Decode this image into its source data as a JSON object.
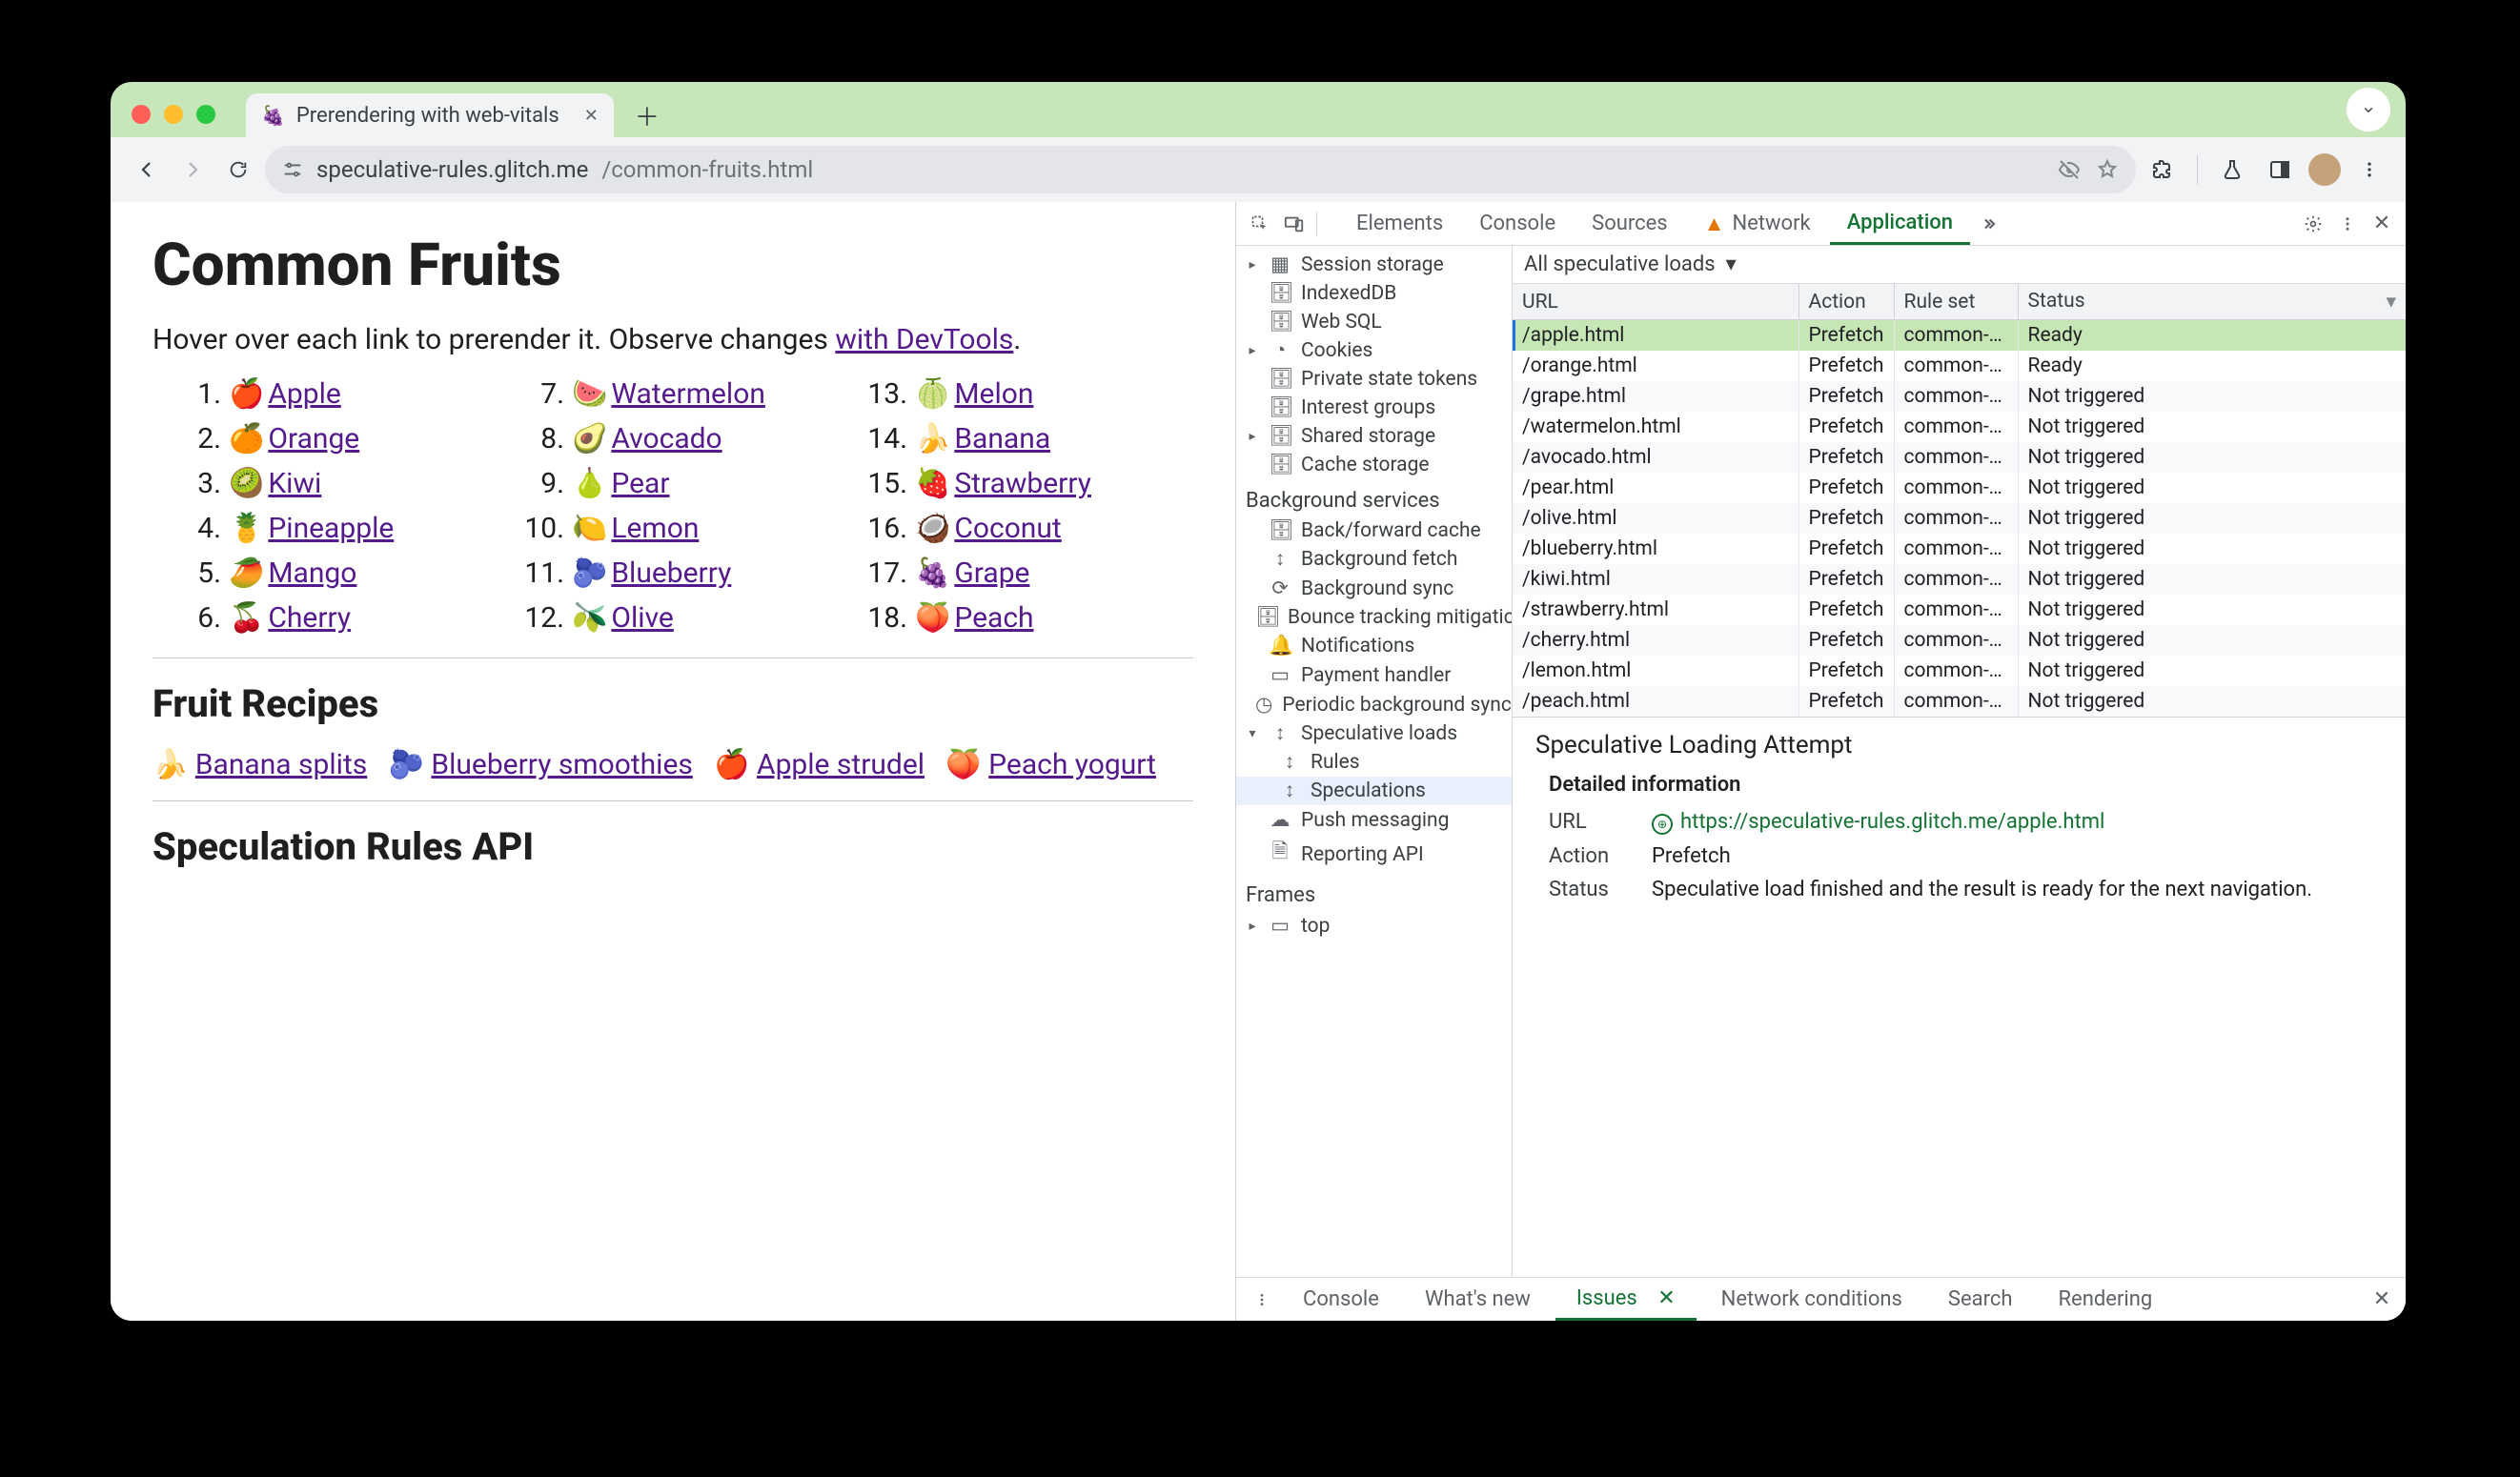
{
  "chrome": {
    "tab_title": "Prerendering with web-vitals",
    "url_site": "speculative-rules.glitch.me",
    "url_path": "/common-fruits.html"
  },
  "page": {
    "h1": "Common Fruits",
    "intro_a": "Hover over each link to prerender it. Observe changes ",
    "intro_link": "with DevTools",
    "intro_b": ".",
    "fruits": [
      {
        "n": "1.",
        "em": "🍎",
        "t": "Apple"
      },
      {
        "n": "2.",
        "em": "🍊",
        "t": "Orange"
      },
      {
        "n": "3.",
        "em": "🥝",
        "t": "Kiwi"
      },
      {
        "n": "4.",
        "em": "🍍",
        "t": "Pineapple"
      },
      {
        "n": "5.",
        "em": "🥭",
        "t": "Mango"
      },
      {
        "n": "6.",
        "em": "🍒",
        "t": "Cherry"
      },
      {
        "n": "7.",
        "em": "🍉",
        "t": "Watermelon"
      },
      {
        "n": "8.",
        "em": "🥑",
        "t": "Avocado"
      },
      {
        "n": "9.",
        "em": "🍐",
        "t": "Pear"
      },
      {
        "n": "10.",
        "em": "🍋",
        "t": "Lemon"
      },
      {
        "n": "11.",
        "em": "🫐",
        "t": "Blueberry"
      },
      {
        "n": "12.",
        "em": "🫒",
        "t": "Olive"
      },
      {
        "n": "13.",
        "em": "🍈",
        "t": "Melon"
      },
      {
        "n": "14.",
        "em": "🍌",
        "t": "Banana"
      },
      {
        "n": "15.",
        "em": "🍓",
        "t": "Strawberry"
      },
      {
        "n": "16.",
        "em": "🥥",
        "t": "Coconut"
      },
      {
        "n": "17.",
        "em": "🍇",
        "t": "Grape"
      },
      {
        "n": "18.",
        "em": "🍑",
        "t": "Peach"
      }
    ],
    "h2a": "Fruit Recipes",
    "recipes": [
      {
        "em": "🍌",
        "t": "Banana splits"
      },
      {
        "em": "🫐",
        "t": "Blueberry smoothies"
      },
      {
        "em": "🍎",
        "t": "Apple strudel"
      },
      {
        "em": "🍑",
        "t": "Peach yogurt"
      }
    ],
    "h2b": "Speculation Rules API"
  },
  "devtools": {
    "tabs": {
      "elements": "Elements",
      "console": "Console",
      "sources": "Sources",
      "network": "Network",
      "application": "Application"
    },
    "nav": {
      "session_storage": "Session storage",
      "indexeddb": "IndexedDB",
      "websql": "Web SQL",
      "cookies": "Cookies",
      "private_state": "Private state tokens",
      "interest_groups": "Interest groups",
      "shared_storage": "Shared storage",
      "cache_storage": "Cache storage",
      "bg_head": "Background services",
      "bf_cache": "Back/forward cache",
      "bg_fetch": "Background fetch",
      "bg_sync": "Background sync",
      "bounce": "Bounce tracking mitigation",
      "notifications": "Notifications",
      "payment": "Payment handler",
      "periodic": "Periodic background sync",
      "spec_loads": "Speculative loads",
      "rules": "Rules",
      "speculations": "Speculations",
      "push": "Push messaging",
      "reporting": "Reporting API",
      "frames_head": "Frames",
      "top": "top"
    },
    "filter": "All speculative loads",
    "cols": {
      "url": "URL",
      "action": "Action",
      "ruleset": "Rule set",
      "status": "Status"
    },
    "rows": [
      {
        "url": "/apple.html",
        "action": "Prefetch",
        "rs": "common-…",
        "status": "Ready",
        "sel": true
      },
      {
        "url": "/orange.html",
        "action": "Prefetch",
        "rs": "common-…",
        "status": "Ready"
      },
      {
        "url": "/grape.html",
        "action": "Prefetch",
        "rs": "common-…",
        "status": "Not triggered"
      },
      {
        "url": "/watermelon.html",
        "action": "Prefetch",
        "rs": "common-…",
        "status": "Not triggered"
      },
      {
        "url": "/avocado.html",
        "action": "Prefetch",
        "rs": "common-…",
        "status": "Not triggered"
      },
      {
        "url": "/pear.html",
        "action": "Prefetch",
        "rs": "common-…",
        "status": "Not triggered"
      },
      {
        "url": "/olive.html",
        "action": "Prefetch",
        "rs": "common-…",
        "status": "Not triggered"
      },
      {
        "url": "/blueberry.html",
        "action": "Prefetch",
        "rs": "common-…",
        "status": "Not triggered"
      },
      {
        "url": "/kiwi.html",
        "action": "Prefetch",
        "rs": "common-…",
        "status": "Not triggered"
      },
      {
        "url": "/strawberry.html",
        "action": "Prefetch",
        "rs": "common-…",
        "status": "Not triggered"
      },
      {
        "url": "/cherry.html",
        "action": "Prefetch",
        "rs": "common-…",
        "status": "Not triggered"
      },
      {
        "url": "/lemon.html",
        "action": "Prefetch",
        "rs": "common-…",
        "status": "Not triggered"
      },
      {
        "url": "/peach.html",
        "action": "Prefetch",
        "rs": "common-…",
        "status": "Not triggered"
      }
    ],
    "detail": {
      "title": "Speculative Loading Attempt",
      "sub": "Detailed information",
      "url_k": "URL",
      "url_v": "https://speculative-rules.glitch.me/apple.html",
      "action_k": "Action",
      "action_v": "Prefetch",
      "status_k": "Status",
      "status_v": "Speculative load finished and the result is ready for the next navigation."
    },
    "drawer": {
      "console": "Console",
      "whatsnew": "What's new",
      "issues": "Issues",
      "netcond": "Network conditions",
      "search": "Search",
      "rendering": "Rendering"
    }
  }
}
